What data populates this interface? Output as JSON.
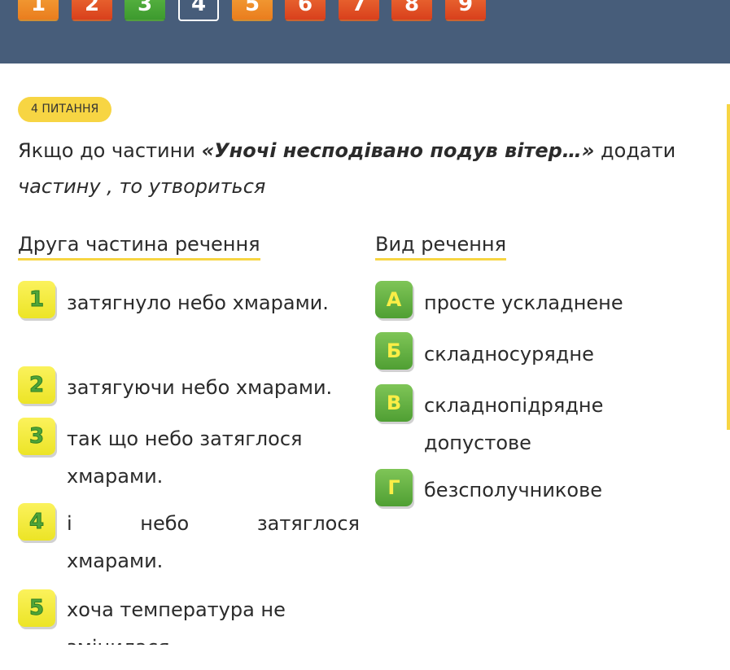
{
  "nav": {
    "buttons": [
      {
        "label": "1",
        "color": "orange"
      },
      {
        "label": "2",
        "color": "red"
      },
      {
        "label": "3",
        "color": "green"
      },
      {
        "label": "4",
        "color": "current"
      },
      {
        "label": "5",
        "color": "orange"
      },
      {
        "label": "6",
        "color": "red"
      },
      {
        "label": "7",
        "color": "red"
      },
      {
        "label": "8",
        "color": "red"
      },
      {
        "label": "9",
        "color": "red"
      }
    ]
  },
  "question": {
    "badge": "4 ПИТАННЯ",
    "text_before": "Якщо до частини ",
    "text_bold": "«Уночі несподівано подув вітер…»",
    "text_after": " додати",
    "text_line2": "частину , то утвориться"
  },
  "columns": {
    "left_title": "Друга частина речення",
    "right_title": "Вид речення"
  },
  "left_options": [
    {
      "key": "1",
      "text": "затягнуло небо хмарами."
    },
    {
      "key": "2",
      "text": "затягуючи небо хмарами."
    },
    {
      "key": "3",
      "line1": "так що небо затяглося",
      "line2": "хмарами."
    },
    {
      "key": "4",
      "words": [
        "і",
        "небо",
        "затяглося"
      ],
      "line2": "хмарами."
    },
    {
      "key": "5",
      "line1": "хоча температура не",
      "line2": "змінилася."
    }
  ],
  "right_options": [
    {
      "key": "А",
      "text": "просте ускладнене"
    },
    {
      "key": "Б",
      "text": "складносурядне"
    },
    {
      "key": "В",
      "line1": "складнопідрядне",
      "line2": "допустове"
    },
    {
      "key": "Г",
      "text": "безсполучникове"
    }
  ],
  "colors": {
    "header_bg": "#475d7a",
    "accent_yellow": "#f7d543",
    "key_green": "#5aa93d"
  }
}
